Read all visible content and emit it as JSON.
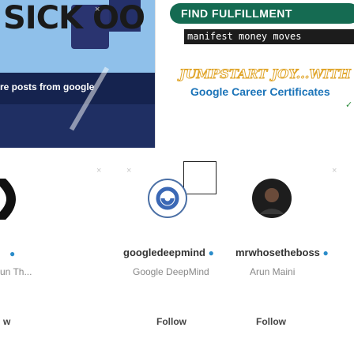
{
  "banner": {
    "left_big_text": "SICK OO",
    "left_caption": "re posts from google",
    "pill_text": "FIND FULFILLMENT",
    "mono_text": "manifest money moves",
    "jumpstart_text": "JUMPSTART JOY...WITH",
    "career_text": "Google Career Certificates"
  },
  "cards": [
    {
      "name": "",
      "sub": "un Th...",
      "follow": "w"
    },
    {
      "name": "googledeepmind",
      "sub": "Google DeepMind",
      "follow": "Follow"
    },
    {
      "name": "mrwhosetheboss",
      "sub": "Arun Maini",
      "follow": "Follow"
    }
  ],
  "icons": {
    "close": "×",
    "verified": "●"
  }
}
